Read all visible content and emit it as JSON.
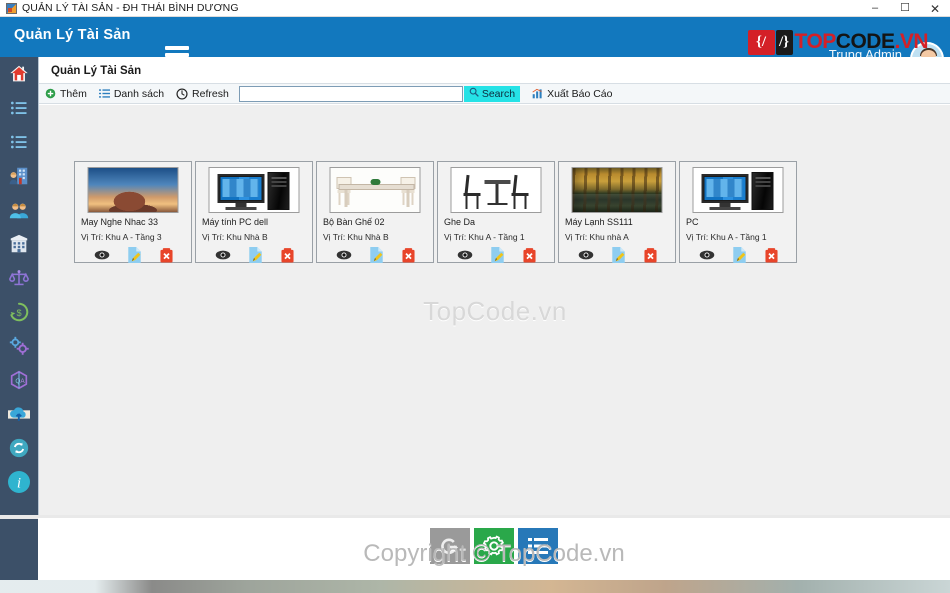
{
  "titlebar": {
    "title": "QUẢN LÝ TÀI SẢN - ĐH THÁI BÌNH DƯƠNG",
    "app_icon": "app-icon",
    "minimize": "–",
    "maximize": "☐",
    "close": "✕"
  },
  "header": {
    "brand": "Quản Lý Tài Sản",
    "menu_icon": "hamburger-icon",
    "user_label": "Trung Admin",
    "avatar": "user-avatar",
    "logo": {
      "mark1": "{/",
      "mark2": "/}",
      "text_red": "TOP",
      "text_dark": "CODE",
      "text_red2": ".VN"
    }
  },
  "sidebar": {
    "items": [
      {
        "icon": "home-icon",
        "name": "sidebar-item-home"
      },
      {
        "icon": "list-icon",
        "name": "sidebar-item-list-1"
      },
      {
        "icon": "list-icon",
        "name": "sidebar-item-list-2"
      },
      {
        "icon": "employee-building-icon",
        "name": "sidebar-item-employees"
      },
      {
        "icon": "users-icon",
        "name": "sidebar-item-users"
      },
      {
        "icon": "building-icon",
        "name": "sidebar-item-department"
      },
      {
        "icon": "scales-icon",
        "name": "sidebar-item-liquidation"
      },
      {
        "icon": "recycle-dollar-icon",
        "name": "sidebar-item-depreciation"
      },
      {
        "icon": "gears-icon",
        "name": "sidebar-item-settings"
      },
      {
        "icon": "cube-icon",
        "name": "sidebar-item-inventory"
      },
      {
        "icon": "cloud-upload-icon",
        "name": "sidebar-item-upload"
      },
      {
        "icon": "refresh-circle-icon",
        "name": "sidebar-item-refresh"
      },
      {
        "icon": "info-icon",
        "name": "sidebar-item-info"
      }
    ]
  },
  "panel": {
    "title": "Quản Lý Tài Sản"
  },
  "toolbar": {
    "add_label": "Thêm",
    "add_icon": "plus-circle-icon",
    "list_label": "Danh sách",
    "list_icon": "list-icon",
    "refresh_label": "Refresh",
    "refresh_icon": "refresh-icon",
    "search_value": "",
    "search_placeholder": "",
    "search_button_label": "Search",
    "search_button_icon": "magnifier-icon",
    "search_button_color": "#25e2e6",
    "export_label": "Xuất Báo Cáo",
    "export_icon": "chart-report-icon"
  },
  "cards": [
    {
      "name": "May Nghe Nhac 33",
      "location": "Vị Trí: Khu A - Tầng 3",
      "thumb": "th-mesa"
    },
    {
      "name": "Máy tính PC dell",
      "location": "Vị Trí: Khu Nhà B",
      "thumb": "th-pc"
    },
    {
      "name": "Bộ Bàn Ghế 02",
      "location": "Vị Trí: Khu Nhà B",
      "thumb": "th-table"
    },
    {
      "name": "Ghe Da",
      "location": "Vị Trí: Khu A - Tầng 1",
      "thumb": "th-ghe"
    },
    {
      "name": "Máy Lạnh SS111",
      "location": "Vị Trí: Khu nhà A",
      "thumb": "th-forest"
    },
    {
      "name": "PC",
      "location": "Vị Trí: Khu A - Tầng 1",
      "thumb": "th-pc"
    }
  ],
  "card_actions": {
    "view": "eye-icon",
    "edit": "edit-document-icon",
    "delete": "delete-trash-icon"
  },
  "watermarks": {
    "center": "TopCode.vn",
    "footer": "Copyright © TopCode.vn"
  },
  "footer_buttons": [
    {
      "name": "footer-button-google",
      "icon": "g-refresh-icon",
      "color": "#9a9a9a"
    },
    {
      "name": "footer-button-settings",
      "icon": "gear-icon",
      "color": "#2aa84a"
    },
    {
      "name": "footer-button-list",
      "icon": "list-icon",
      "color": "#2778b8"
    }
  ]
}
